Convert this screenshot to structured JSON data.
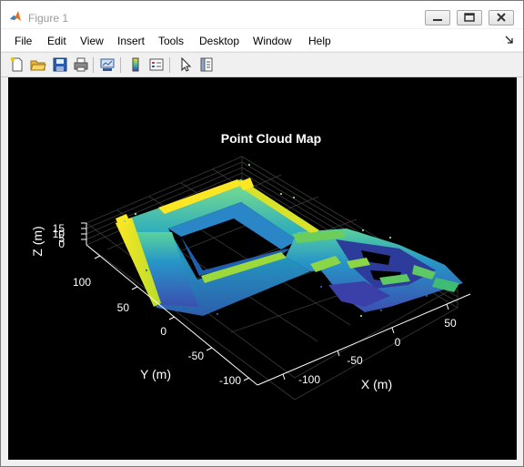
{
  "window": {
    "title": "Figure 1"
  },
  "menubar": {
    "items": [
      "File",
      "Edit",
      "View",
      "Insert",
      "Tools",
      "Desktop",
      "Window",
      "Help"
    ]
  },
  "toolbar": {
    "icons": [
      "new-figure-icon",
      "open-file-icon",
      "save-icon",
      "print-icon",
      "link-plot-icon",
      "colorbar-icon",
      "legend-icon",
      "edit-plot-arrow-icon",
      "property-inspector-icon"
    ]
  },
  "plot": {
    "title": "Point Cloud Map",
    "xlabel": "X (m)",
    "ylabel": "Y (m)",
    "zlabel": "Z (m)",
    "x_ticks": [
      "-100",
      "-50",
      "0",
      "50"
    ],
    "y_ticks": [
      "100",
      "50",
      "0",
      "-50",
      "-100"
    ],
    "z_ticks": [
      "15",
      "10",
      "5",
      "0"
    ]
  },
  "chart_data": {
    "type": "scatter",
    "title": "Point Cloud Map",
    "xlabel": "X (m)",
    "ylabel": "Y (m)",
    "zlabel": "Z (m)",
    "x_ticks": [
      -100,
      -50,
      0,
      50
    ],
    "y_ticks": [
      -100,
      -50,
      0,
      50,
      100
    ],
    "z_ticks": [
      0,
      5,
      10,
      15
    ],
    "xlim": [
      -140,
      80
    ],
    "ylim": [
      -120,
      130
    ],
    "zlim": [
      0,
      15
    ],
    "background": "#000000",
    "axis_color": "#ffffff",
    "colormap": [
      "#3b0f70",
      "#2c5ead",
      "#21a5c4",
      "#5ad39b",
      "#fde725"
    ]
  },
  "colors": {
    "figure_background": "#000000",
    "text": "#ffffff",
    "title_text": "#999999"
  }
}
